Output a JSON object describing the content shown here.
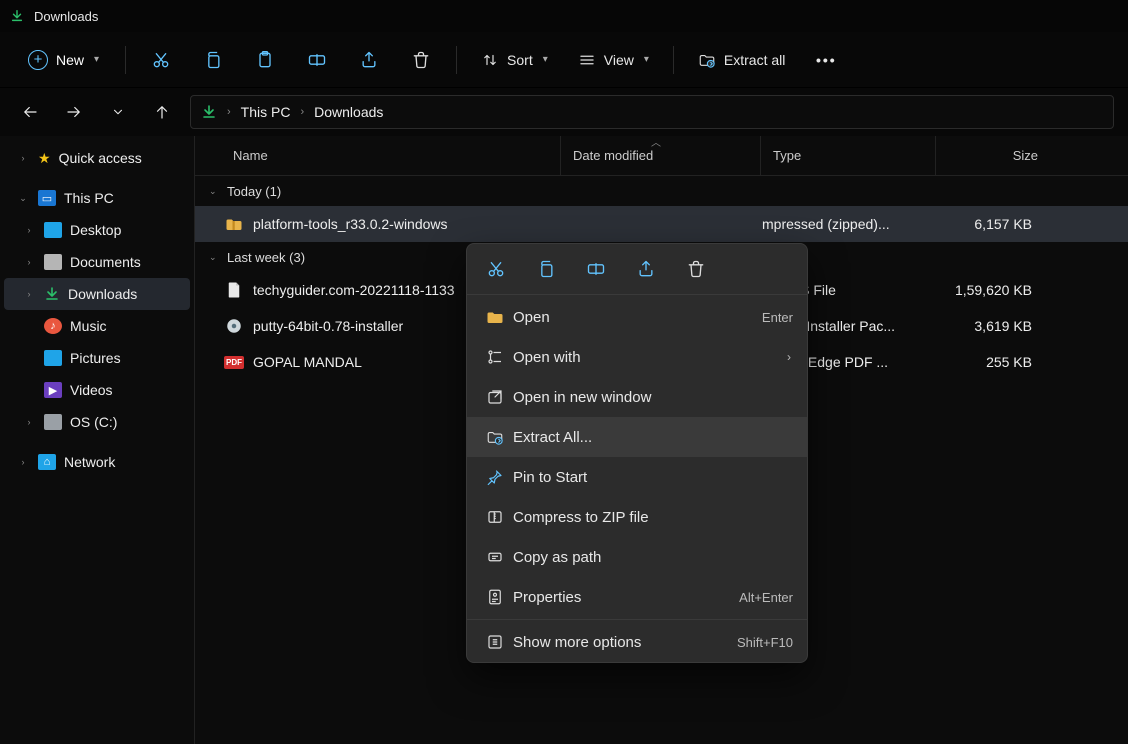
{
  "window": {
    "title": "Downloads"
  },
  "toolbar": {
    "new": "New",
    "sort": "Sort",
    "view": "View",
    "extract_all": "Extract all"
  },
  "breadcrumb": {
    "items": [
      "This PC",
      "Downloads"
    ]
  },
  "sidebar": {
    "quick_access": "Quick access",
    "this_pc": "This PC",
    "items": {
      "desktop": "Desktop",
      "documents": "Documents",
      "downloads": "Downloads",
      "music": "Music",
      "pictures": "Pictures",
      "videos": "Videos",
      "os_c": "OS (C:)"
    },
    "network": "Network"
  },
  "columns": {
    "name": "Name",
    "date": "Date modified",
    "type": "Type",
    "size": "Size"
  },
  "groups": [
    {
      "title": "Today (1)"
    },
    {
      "title": "Last week (3)"
    }
  ],
  "files": {
    "f0": {
      "name": "platform-tools_r33.0.2-windows",
      "type": "mpressed (zipped)...",
      "size": "6,157 KB"
    },
    "f1": {
      "name": "techyguider.com-20221118-1133",
      "type": "PRESS File",
      "size": "1,59,620 KB"
    },
    "f2": {
      "name": "putty-64bit-0.78-installer",
      "type": "ndows Installer Pac...",
      "size": "3,619 KB"
    },
    "f3": {
      "name": "GOPAL MANDAL",
      "type": "crosoft Edge PDF ...",
      "size": "255 KB"
    }
  },
  "context": {
    "open": "Open",
    "open_accel": "Enter",
    "open_with": "Open with",
    "open_new_window": "Open in new window",
    "extract_all": "Extract All...",
    "pin_start": "Pin to Start",
    "compress_zip": "Compress to ZIP file",
    "copy_path": "Copy as path",
    "properties": "Properties",
    "properties_accel": "Alt+Enter",
    "show_more": "Show more options",
    "show_more_accel": "Shift+F10"
  }
}
